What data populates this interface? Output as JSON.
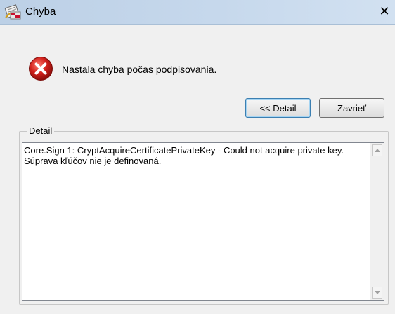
{
  "window": {
    "title": "Chyba",
    "close_symbol": "✕"
  },
  "message": {
    "text": "Nastala chyba počas podpisovania.",
    "icon": "error-icon"
  },
  "buttons": {
    "detail_label": "<< Detail",
    "close_label": "Zavrieť"
  },
  "detail_group": {
    "legend": "Detail",
    "lines": [
      "Core.Sign 1: CryptAcquireCertificatePrivateKey - Could not acquire private key.",
      "Súprava kľúčov nie je definovaná."
    ]
  },
  "colors": {
    "error_red": "#d0201b",
    "titlebar": "#c6d8ec",
    "dialog_bg": "#f0f0f0"
  }
}
